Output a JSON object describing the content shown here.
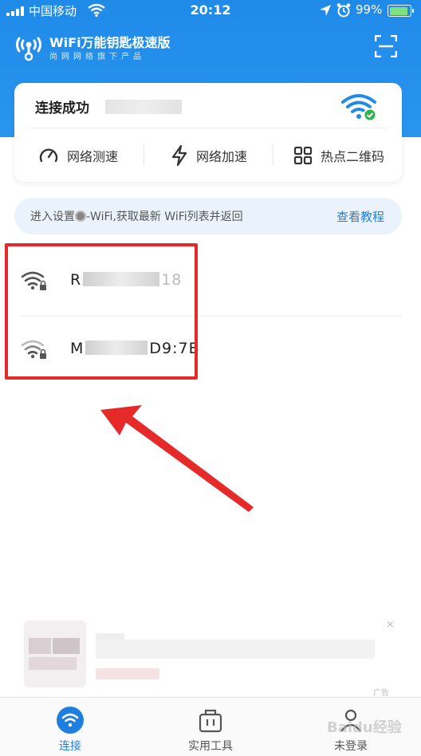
{
  "status_bar": {
    "carrier": "中国移动",
    "time": "20:12",
    "battery": "99%"
  },
  "header": {
    "app_title": "WiFi万能钥匙极速版",
    "app_subtitle": "尚网网络旗下产品"
  },
  "connection_card": {
    "status": "连接成功",
    "tools": [
      {
        "label": "网络测速",
        "icon": "speedometer-icon"
      },
      {
        "label": "网络加速",
        "icon": "lightning-icon"
      },
      {
        "label": "热点二维码",
        "icon": "qr-grid-icon"
      }
    ]
  },
  "tip": {
    "text_before": "进入设置",
    "text_after": "-WiFi,获取最新 WiFi列表并返回",
    "link": "查看教程"
  },
  "wifi_list": [
    {
      "ssid_visible": "R",
      "ssid_tail": "18",
      "locked": true,
      "icon": "wifi-lock-icon"
    },
    {
      "ssid_visible": "M",
      "ssid_tail": "D9:7B",
      "locked": true,
      "icon": "wifi-lock-icon"
    }
  ],
  "ad": {
    "tag": "广告",
    "close": "×"
  },
  "tabbar": {
    "tabs": [
      {
        "label": "连接",
        "icon": "wifi-tab-icon",
        "active": true
      },
      {
        "label": "实用工具",
        "icon": "toolbox-icon",
        "active": false
      },
      {
        "label": "未登录",
        "icon": "user-icon",
        "active": false
      }
    ]
  },
  "watermark": "Baidu经验",
  "colors": {
    "brand_blue": "#1f8ae8",
    "accent_blue": "#1f7fe0",
    "annotation_red": "#e62a2a",
    "success_green": "#2db34a"
  }
}
